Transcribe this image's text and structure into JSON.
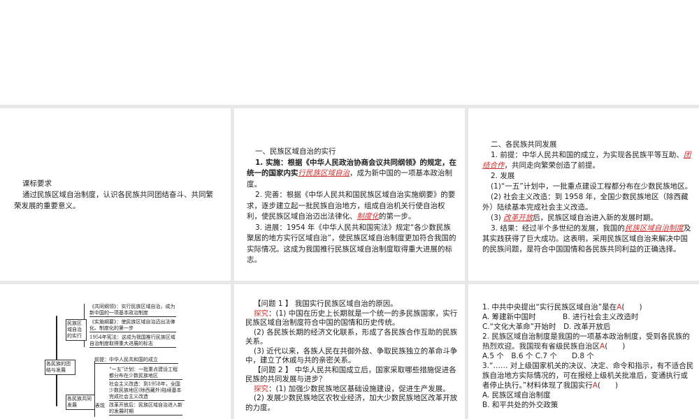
{
  "slide1": {
    "heading": "课标要求",
    "body": "通过民族区域自治制度，认识各民族共同团结奋斗、共同繁荣发展的重要意义。"
  },
  "slide2": {
    "heading": "一、民族区域自治的实行",
    "p1a": "1. 实施：根据《中华人民政治协商会议共同纲领》的规定，在统一的国家内实",
    "p1r": "行民族区域自治",
    "p1b": "，成为新中国的一项基本政治制度。",
    "p2a": "2. 完善：根据《中华人民共和国民族区域自治实施纲要》的要求，逐步建立起一批民族自治地方，组成自治机关行使自治权利，使民族区域自治迈出法律化、",
    "p2r": "制度化",
    "p2b": "的第一步。",
    "p3": "3. 进展：1954 年《中华人民共和国宪法》规定“各少数民族聚居的地方实行区域自治”，使民族区域自治制度更加符合我国的实际情况。这成为我国推行民族区域自治制度取得重大进展的标志。"
  },
  "slide3": {
    "heading": "二、各民族共同发展",
    "p1a": "1. 前提：中华人民共和国的成立，为实现各民族平等互助、",
    "p1r": "团结合作",
    "p1b": "，共同走向繁荣创造了前提。",
    "p2": "2. 发展",
    "p3": "(1)“一五”计划中，一批重点建设工程都分布在少数民族地区。",
    "p4": "(2) 社会主义改造：到 1958 年，全国少数民族地区（除西藏外）陆续基本完成社会主义改造。",
    "p5a": "(3) ",
    "p5r": "改革开放",
    "p5b": "后，民族区域自治进入新的发展时期。",
    "p6a": "3. 结果：经过半个多世纪的发展，我国的",
    "p6r": "民族区域自治制度",
    "p6b": "及其实践获得了巨大成功。这表明，采用民族区域自治来解决中国的民族问题，是符合中国国情和各民族共同利益的正确选择。"
  },
  "mindmap": {
    "root": "各民族的团结与发展",
    "b1": "民族区域自治的实行",
    "b1_1": "《共同纲领》：实行民族区域自治，成为新中国的一项基本政治制度",
    "b1_2": "《实施纲要》：使民族区域自治迈出法律化、制度化的第一步",
    "b1_3": "1954年宪法：这成为我国推行民族区域自治制度取得重大进展的标志",
    "b2": "各民族共同发展",
    "b2_1": "前提：中华人民共和国的成立",
    "b2_label": "表现",
    "b2_2": "“一五”计划：一批重点建设工程都分布在少数民族地区",
    "b2_3": "社会主义改造：到1958年，全国少数民族地区(除西藏外)陆续基本完成社会主义改造",
    "b2_4": "改革开放后：民族区域自治进入新的发展时期"
  },
  "slide5": {
    "q1": "【问题 1 】 我国实行民族区域自治的原因。",
    "tag": "探究",
    "q1a": "：(1) 中国在历史上长期就是一个统一的多民族国家，实行民族区域自治制度符合中国的国情和历史传统。",
    "q1b": "(2) 各民族长期的经济文化联系，形成了各民族合作互助的民族关系。",
    "q1c": "(3) 近代以来，各族人民在共御外敌、争取民族独立的革命斗争中，建立了休戚与共的亲密关系。",
    "q2": "【问题 2 】 中华人民共和国成立后，国家采取哪些措施促进各民族的共同发展与进步？",
    "q2a": "：(1) 加强少数民族地区基础设施建设，促进生产发展。",
    "q2b": "(2) 发展少数民族地区农牧业经济，加大少数民族地区改革开放的力度。"
  },
  "slide6": {
    "q1": "1. 中共中央提出“实行民族区域自治”是在",
    "a1": "A",
    "q1o1": "A. 筹建新中国时",
    "q1o2": "B. 进行社会主义改造时",
    "q1o3": "C.“文化大革命”开始时",
    "q1o4": "D. 改革开放后",
    "q2": "2. 民族区域自治制度是我国的一项基本政治制度，受到各民族的热烈欢迎。我国现有省级民族自治区",
    "a2": "A",
    "q2o": "A.5 个　B.6 个 C.7 个　　D.8 个",
    "q3": "3.“…… 对上级国家机关的决议、决定、命令和指示，有不适合民族自治地方实际情况的，可在报经上级机关批准后，变通执行或者停止执行。”材料体现了我国实行",
    "a3": "A",
    "q3o1": "A. 民族区域自治制度",
    "q3o2": "B. 和平共处的外交政策",
    "paren": "(　　)"
  }
}
